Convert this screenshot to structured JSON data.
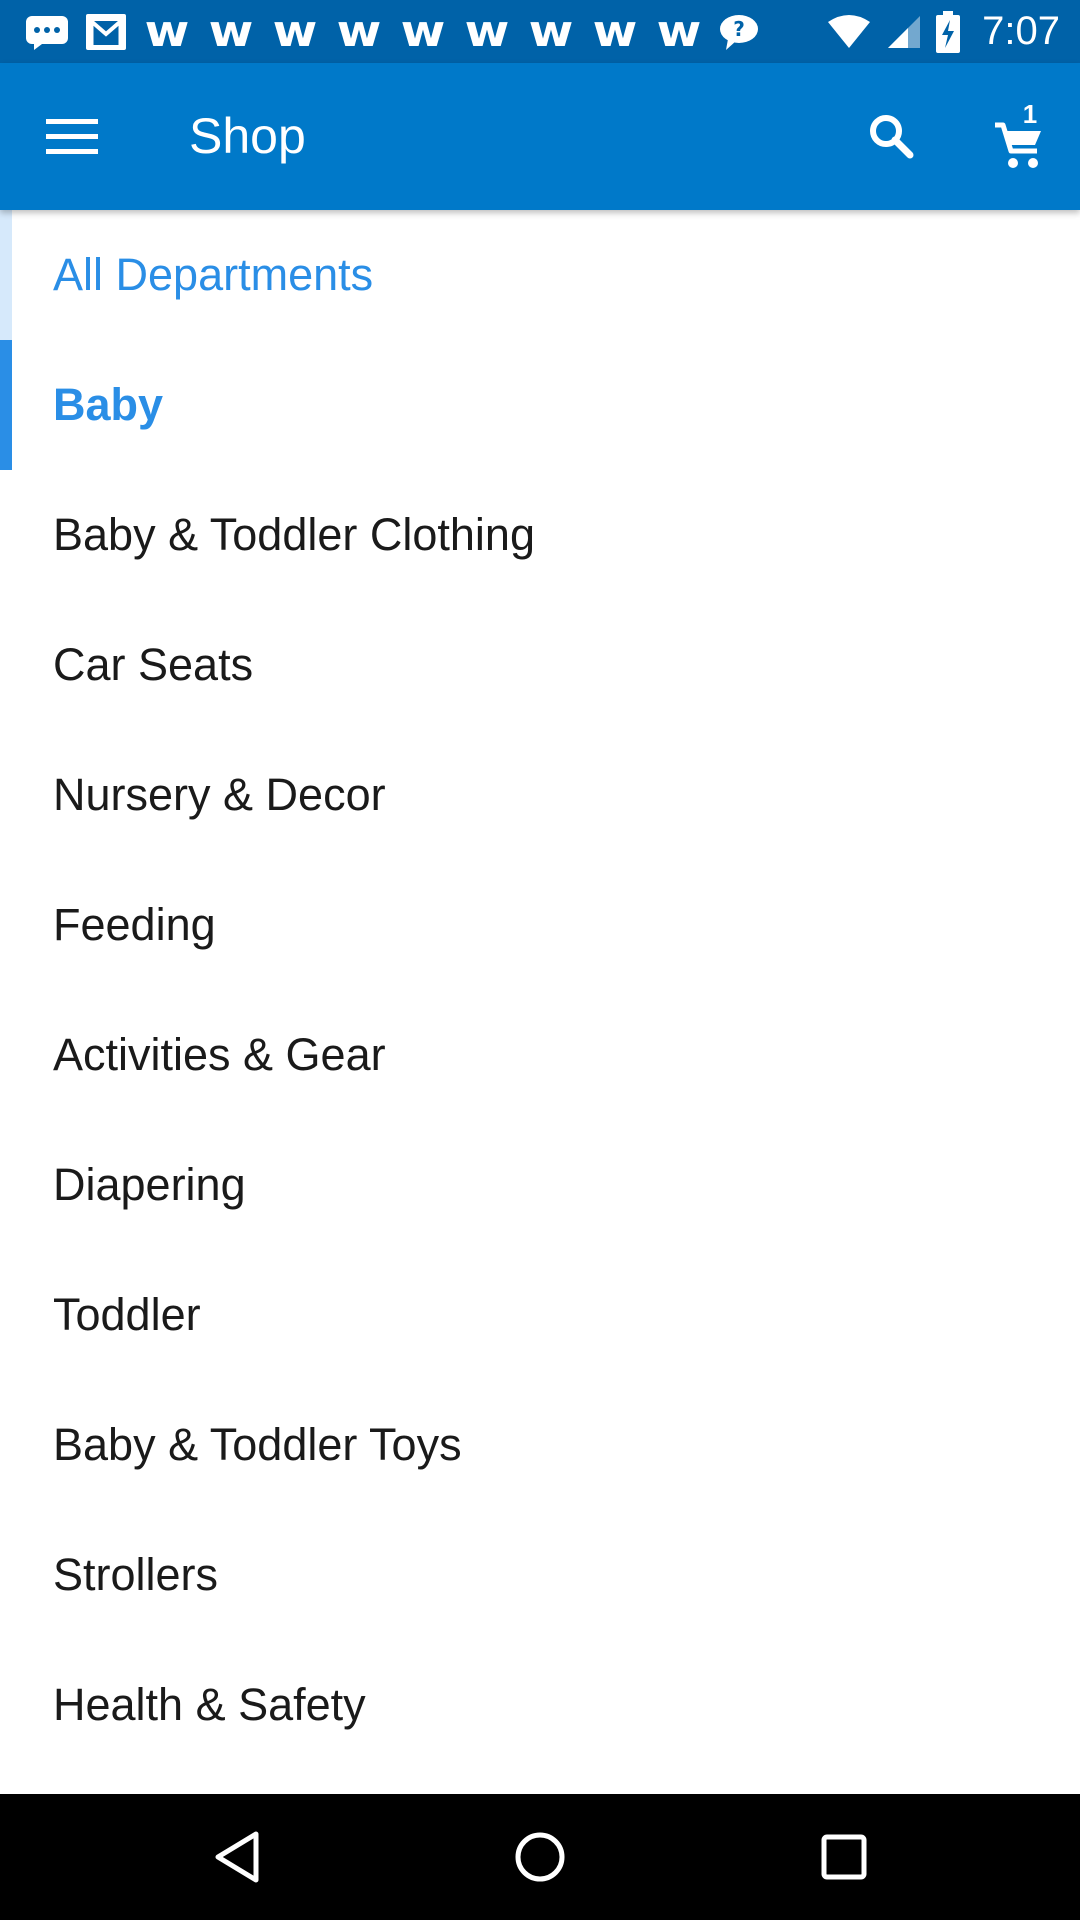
{
  "status_bar": {
    "time": "7:07",
    "notification_icons": [
      "message-icon",
      "gmail-icon",
      "walmart-icon",
      "walmart-icon",
      "walmart-icon",
      "walmart-icon",
      "walmart-icon",
      "walmart-icon",
      "walmart-icon",
      "walmart-icon",
      "walmart-icon",
      "chat-bubble-icon"
    ],
    "walmart_glyph": "w",
    "status_icons": [
      "wifi-icon",
      "cell-signal-icon",
      "battery-charging-icon"
    ]
  },
  "app_bar": {
    "title": "Shop",
    "cart_count": "1",
    "background_color": "#0079c9"
  },
  "departments": {
    "header": "All Departments",
    "selected": "Baby",
    "items": [
      "Baby & Toddler Clothing",
      "Car Seats",
      "Nursery & Decor",
      "Feeding",
      "Activities & Gear",
      "Diapering",
      "Toddler",
      "Baby & Toddler Toys",
      "Strollers",
      "Health & Safety"
    ],
    "accent_color": "#2a8ee6"
  },
  "nav_bar": {
    "buttons": [
      "back-icon",
      "home-icon",
      "recents-icon"
    ]
  }
}
